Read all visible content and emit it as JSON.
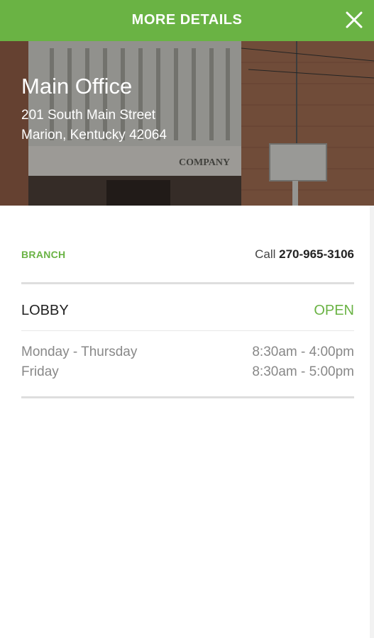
{
  "header": {
    "title": "MORE DETAILS",
    "close_icon": "close-icon"
  },
  "location": {
    "name": "Main Office",
    "address_line1": "201 South Main Street",
    "address_line2": "Marion, Kentucky 42064",
    "building_sign_text": "COMPANY"
  },
  "branch": {
    "type_label": "BRANCH",
    "call_prefix": "Call",
    "phone": "270-965-3106"
  },
  "lobby": {
    "label": "LOBBY",
    "status": "OPEN",
    "hours": [
      {
        "days": "Monday - Thursday",
        "time": "8:30am - 4:00pm"
      },
      {
        "days": "Friday",
        "time": "8:30am - 5:00pm"
      }
    ]
  },
  "colors": {
    "accent": "#6ab344",
    "text_dark": "#222222",
    "text_muted": "#888888"
  }
}
